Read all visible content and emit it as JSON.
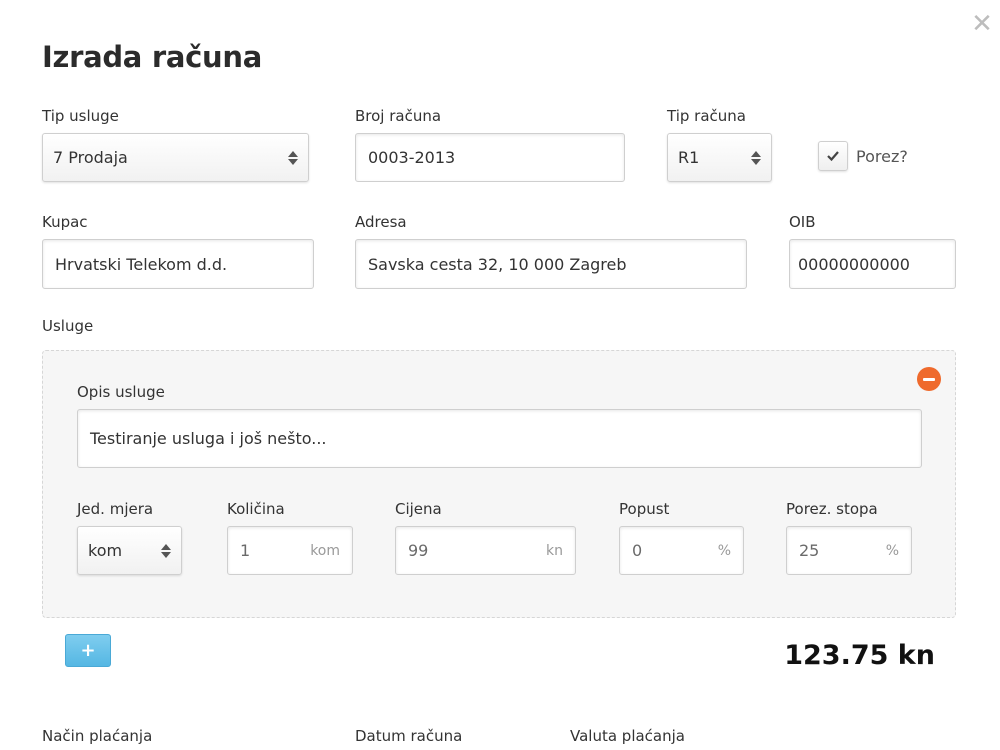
{
  "dialog": {
    "title": "Izrada računa",
    "close_glyph": "✕"
  },
  "fields": {
    "tip_usluge": {
      "label": "Tip usluge",
      "value": "7 Prodaja"
    },
    "broj_racuna": {
      "label": "Broj računa",
      "value": "0003-2013"
    },
    "tip_racuna": {
      "label": "Tip računa",
      "value": "R1"
    },
    "porez": {
      "label": "Porez?",
      "checked": true
    },
    "kupac": {
      "label": "Kupac",
      "value": "Hrvatski Telekom d.d."
    },
    "adresa": {
      "label": "Adresa",
      "value": "Savska cesta 32, 10 000 Zagreb"
    },
    "oib": {
      "label": "OIB",
      "value": "00000000000"
    }
  },
  "services": {
    "label": "Usluge",
    "items": [
      {
        "opis_label": "Opis usluge",
        "opis_value": "Testiranje usluga i još nešto...",
        "jed_mjera": {
          "label": "Jed. mjera",
          "value": "kom"
        },
        "kolicina": {
          "label": "Količina",
          "value": "1",
          "unit": "kom"
        },
        "cijena": {
          "label": "Cijena",
          "value": "99",
          "unit": "kn"
        },
        "popust": {
          "label": "Popust",
          "value": "0",
          "unit": "%"
        },
        "porez_stopa": {
          "label": "Porez. stopa",
          "value": "25",
          "unit": "%"
        }
      }
    ],
    "add_button": "+",
    "total": "123.75 kn"
  },
  "footer_labels": {
    "nacin_placanja": "Način plaćanja",
    "datum_racuna": "Datum računa",
    "valuta_placanja": "Valuta plaćanja"
  },
  "colors": {
    "accent_blue": "#55b7e3",
    "remove_orange": "#ef6a2c"
  }
}
